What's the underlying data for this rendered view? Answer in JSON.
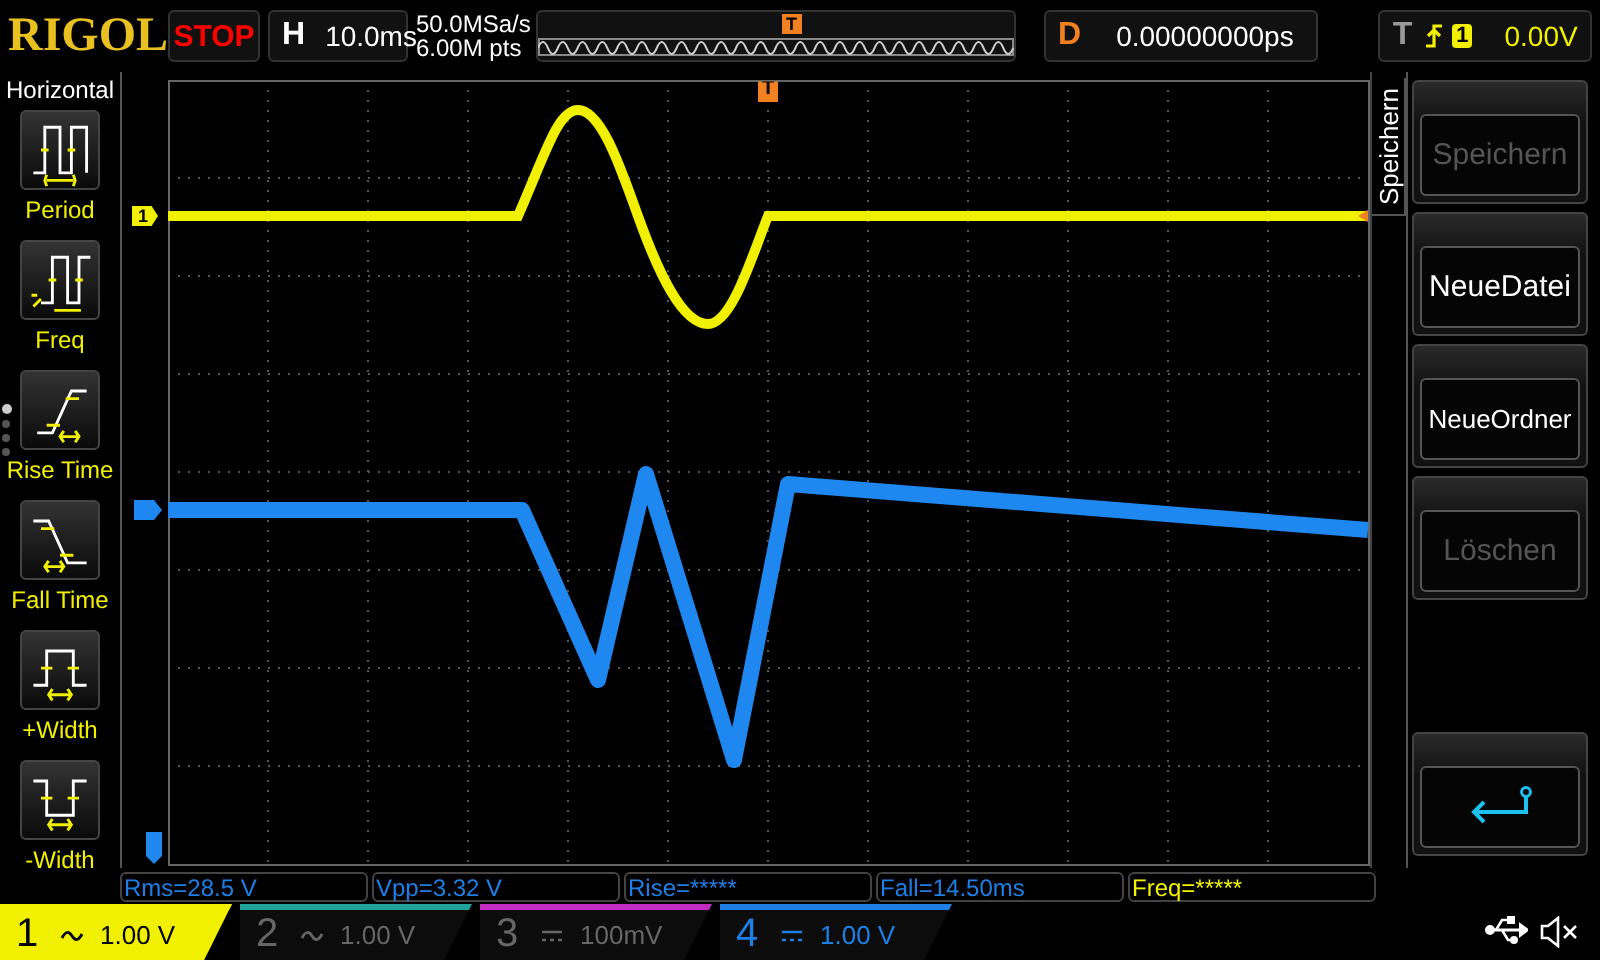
{
  "top_bar": {
    "brand": "RIGOL",
    "run_state": "STOP",
    "timebase": {
      "label": "H",
      "value": "10.0ms"
    },
    "acquisition": {
      "sample_rate": "50.0MSa/s",
      "memory_depth": "6.00M pts"
    },
    "trigger_position": {
      "label": "T"
    },
    "delay": {
      "label": "D",
      "value": "0.00000000ps"
    },
    "trigger": {
      "label": "T",
      "source": "1",
      "value": "0.00V"
    }
  },
  "measure_menu": {
    "title": "Horizontal",
    "items": [
      {
        "label": "Period",
        "kind": "period"
      },
      {
        "label": "Freq",
        "kind": "freq"
      },
      {
        "label": "Rise Time",
        "kind": "rise"
      },
      {
        "label": "Fall Time",
        "kind": "fall"
      },
      {
        "label": "+Width",
        "kind": "pwidth"
      },
      {
        "label": "-Width",
        "kind": "nwidth"
      }
    ],
    "pages": [
      {
        "selected": true
      },
      {
        "selected": false
      },
      {
        "selected": false
      },
      {
        "selected": false
      }
    ]
  },
  "screen": {
    "trigger_marker": "T",
    "channel_markers": [
      {
        "label": "1",
        "color": "#f0f000"
      }
    ]
  },
  "save_menu": {
    "title": "Speichern",
    "items": [
      {
        "kind": "text",
        "label": "Speichern",
        "disabled": true
      },
      {
        "kind": "text",
        "label": "NeueDatei",
        "disabled": false
      },
      {
        "kind": "text",
        "label": "NeueOrdner",
        "disabled": false
      },
      {
        "kind": "text",
        "label": "Löschen",
        "disabled": true
      },
      {
        "kind": "back"
      }
    ]
  },
  "measurements": [
    {
      "text": "Rms=28.5 V",
      "color": "#1e7fe6"
    },
    {
      "text": "Vpp=3.32 V",
      "color": "#1e7fe6"
    },
    {
      "text": "Rise=*****",
      "color": "#1e7fe6"
    },
    {
      "text": "Fall=14.50ms",
      "color": "#1e7fe6"
    },
    {
      "text": "Freq=*****",
      "color": "#f0f000"
    }
  ],
  "channels": [
    {
      "number": "1",
      "kind": "ac",
      "scale": "1.00 V",
      "on": true,
      "selected": true,
      "color": "#f0f000"
    },
    {
      "number": "2",
      "kind": "ac",
      "scale": "1.00 V",
      "on": false,
      "selected": false,
      "color": "#1fa39a"
    },
    {
      "number": "3",
      "kind": "dc",
      "scale": "100mV",
      "on": false,
      "selected": false,
      "color": "#c02cc0"
    },
    {
      "number": "4",
      "kind": "dc",
      "scale": "1.00 V",
      "on": true,
      "selected": false,
      "color": "#1e7fe6"
    }
  ]
}
